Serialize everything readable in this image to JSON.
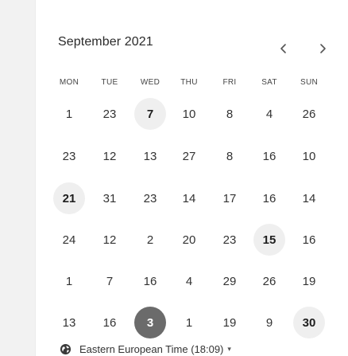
{
  "calendar": {
    "month_title": "September 2021",
    "weekdays": [
      "MON",
      "TUE",
      "WED",
      "THU",
      "FRI",
      "SAT",
      "SUN"
    ],
    "weeks": [
      [
        {
          "label": "1",
          "state": "default"
        },
        {
          "label": "23",
          "state": "default"
        },
        {
          "label": "7",
          "state": "available"
        },
        {
          "label": "10",
          "state": "default"
        },
        {
          "label": "8",
          "state": "default"
        },
        {
          "label": "4",
          "state": "default"
        },
        {
          "label": "26",
          "state": "default"
        }
      ],
      [
        {
          "label": "23",
          "state": "default"
        },
        {
          "label": "12",
          "state": "default"
        },
        {
          "label": "13",
          "state": "default"
        },
        {
          "label": "27",
          "state": "default"
        },
        {
          "label": "8",
          "state": "default"
        },
        {
          "label": "16",
          "state": "default"
        },
        {
          "label": "10",
          "state": "default"
        }
      ],
      [
        {
          "label": "21",
          "state": "available"
        },
        {
          "label": "31",
          "state": "default"
        },
        {
          "label": "23",
          "state": "default"
        },
        {
          "label": "14",
          "state": "default"
        },
        {
          "label": "17",
          "state": "default"
        },
        {
          "label": "16",
          "state": "default"
        },
        {
          "label": "14",
          "state": "default"
        }
      ],
      [
        {
          "label": "24",
          "state": "default"
        },
        {
          "label": "12",
          "state": "default"
        },
        {
          "label": "2",
          "state": "default"
        },
        {
          "label": "20",
          "state": "default"
        },
        {
          "label": "23",
          "state": "default"
        },
        {
          "label": "15",
          "state": "available"
        },
        {
          "label": "16",
          "state": "default"
        }
      ],
      [
        {
          "label": "1",
          "state": "default"
        },
        {
          "label": "7",
          "state": "default"
        },
        {
          "label": "16",
          "state": "default"
        },
        {
          "label": "4",
          "state": "default"
        },
        {
          "label": "29",
          "state": "default"
        },
        {
          "label": "26",
          "state": "default"
        },
        {
          "label": "19",
          "state": "default"
        }
      ],
      [
        {
          "label": "13",
          "state": "default"
        },
        {
          "label": "16",
          "state": "default"
        },
        {
          "label": "3",
          "state": "selected"
        },
        {
          "label": "1",
          "state": "default"
        },
        {
          "label": "19",
          "state": "default"
        },
        {
          "label": "9",
          "state": "default"
        },
        {
          "label": "30",
          "state": "available"
        }
      ]
    ]
  },
  "nav": {
    "prev_icon": "chevron-left-icon",
    "next_icon": "chevron-right-icon"
  },
  "timezone": {
    "icon": "globe-icon",
    "label": "Eastern European Time (18:09)",
    "caret": "▾"
  },
  "colors": {
    "background": "#f2f2f2",
    "card": "#ffffff",
    "available_bg": "#efefef",
    "selected_bg": "#6b6b6b",
    "selected_text": "#ffffff",
    "text": "#333333"
  }
}
